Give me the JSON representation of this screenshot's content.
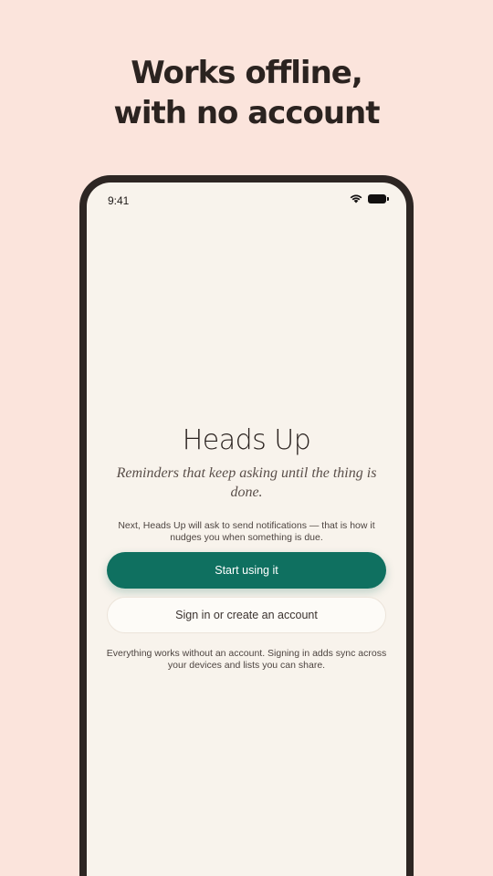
{
  "headline": {
    "line1": "Works offline,",
    "line2": "with no account"
  },
  "status_bar": {
    "time": "9:41",
    "icons": [
      "wifi-icon",
      "battery-icon"
    ]
  },
  "app": {
    "title": "Heads Up",
    "tagline": "Reminders that keep asking until the thing is done.",
    "notification_note": "Next, Heads Up will ask to send notifications — that is how it nudges you when something is due.",
    "primary_button": "Start using it",
    "secondary_button": "Sign in or create an account",
    "account_note": "Everything works without an account. Signing in adds sync across your devices and lists you can share."
  },
  "colors": {
    "background": "#fbe4dc",
    "device_frame": "#2d2623",
    "screen": "#f8f3ec",
    "accent": "#0f7060"
  }
}
